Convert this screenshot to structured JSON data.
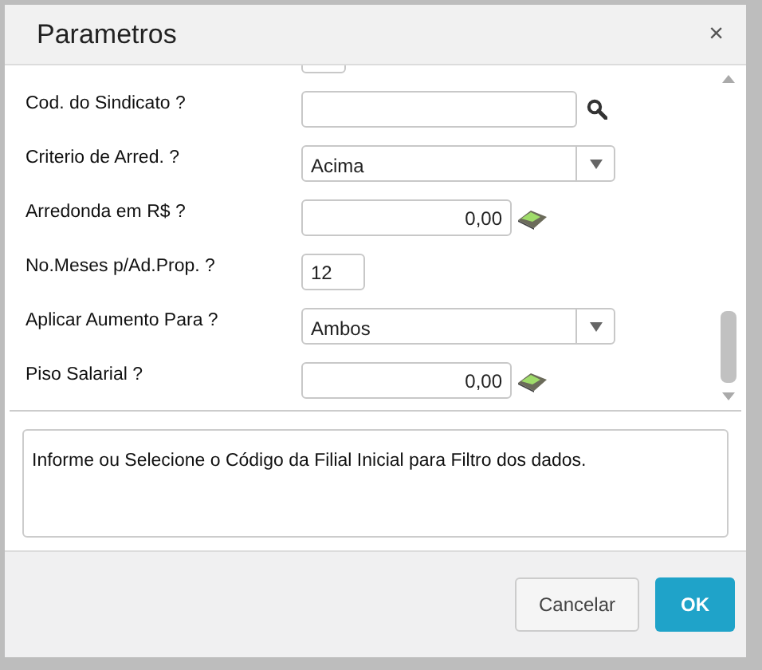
{
  "window": {
    "title": "Parametros",
    "close": "×"
  },
  "fields": [
    {
      "kind": "text"
    },
    {
      "kind": "search",
      "label": "Cod. do Sindicato ?"
    },
    {
      "kind": "select",
      "label": "Criterio de Arred. ?",
      "value": "Acima"
    },
    {
      "kind": "money",
      "label": "Arredonda em R$ ?",
      "value": "0,00"
    },
    {
      "kind": "short",
      "label": "No.Meses p/Ad.Prop. ?",
      "value": "12"
    },
    {
      "kind": "select",
      "label": "Aplicar Aumento Para ?",
      "value": "Ambos"
    },
    {
      "kind": "money",
      "label": "Piso Salarial ?",
      "value": "0,00"
    }
  ],
  "help": "Informe ou Selecione o Código da Filial Inicial para Filtro dos dados.",
  "buttons": [
    {
      "label": "Cancelar",
      "kind": "secondary"
    },
    {
      "label": "OK",
      "kind": "primary"
    }
  ]
}
